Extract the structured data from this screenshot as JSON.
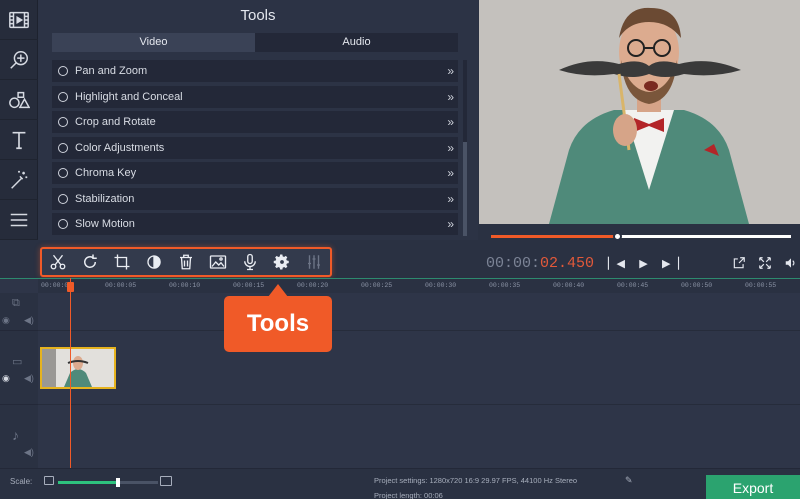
{
  "panel": {
    "title": "Tools",
    "tabs": [
      {
        "label": "Video",
        "active": true
      },
      {
        "label": "Audio",
        "active": false
      }
    ],
    "items": [
      {
        "label": "Pan and Zoom"
      },
      {
        "label": "Highlight and Conceal"
      },
      {
        "label": "Crop and Rotate"
      },
      {
        "label": "Color Adjustments"
      },
      {
        "label": "Chroma Key"
      },
      {
        "label": "Stabilization"
      },
      {
        "label": "Slow Motion"
      }
    ]
  },
  "sidebar": {
    "icons": [
      "film-import-icon",
      "zoom-plus-icon",
      "shapes-icon",
      "text-icon",
      "magic-wand-icon",
      "list-icon"
    ]
  },
  "preview": {
    "progress": 0.42
  },
  "toolbar": {
    "tools": [
      "cut-icon",
      "rotate-icon",
      "crop-icon",
      "color-adjust-icon",
      "trash-icon",
      "image-icon",
      "microphone-icon",
      "gear-icon",
      "equalizer-icon"
    ]
  },
  "timecode": {
    "grey_part": "00:00:",
    "red_part": "02.450"
  },
  "ruler": {
    "labels": [
      "00:00:00",
      "00:00:05",
      "00:00:10",
      "00:00:15",
      "00:00:20",
      "00:00:25",
      "00:00:30",
      "00:00:35",
      "00:00:40",
      "00:00:45",
      "00:00:50",
      "00:00:55"
    ]
  },
  "callout": {
    "text": "Tools"
  },
  "status": {
    "scale_label": "Scale:",
    "scale_value": 0.6,
    "project_settings": "Project settings:   1280x720 16:9 29.97 FPS, 44100 Hz Stereo",
    "project_length": "Project length:    00:06"
  },
  "export": {
    "label": "Export"
  },
  "colors": {
    "accent": "#f05a28",
    "export": "#2ba36f",
    "clip_border": "#e6b31e"
  }
}
